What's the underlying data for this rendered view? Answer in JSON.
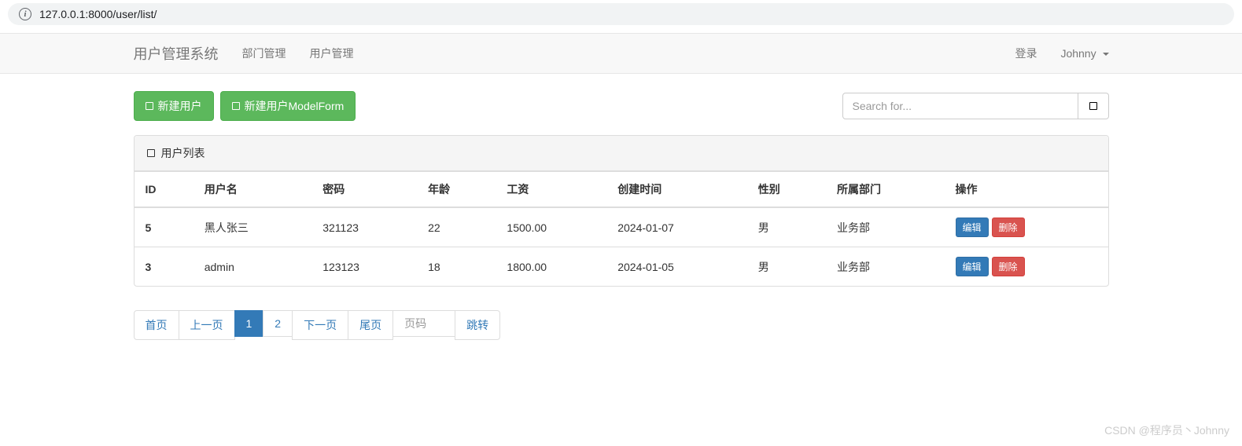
{
  "url": "127.0.0.1:8000/user/list/",
  "nav": {
    "brand": "用户管理系统",
    "items": [
      "部门管理",
      "用户管理"
    ],
    "login": "登录",
    "user": "Johnny"
  },
  "buttons": {
    "new_user": "新建用户",
    "new_user_modelform": "新建用户ModelForm"
  },
  "search": {
    "placeholder": "Search for..."
  },
  "panel": {
    "title": "用户列表"
  },
  "table": {
    "headers": [
      "ID",
      "用户名",
      "密码",
      "年龄",
      "工资",
      "创建时间",
      "性别",
      "所属部门",
      "操作"
    ],
    "rows": [
      {
        "id": "5",
        "username": "黑人张三",
        "password": "321123",
        "age": "22",
        "salary": "1500.00",
        "created": "2024-01-07",
        "gender": "男",
        "dept": "业务部"
      },
      {
        "id": "3",
        "username": "admin",
        "password": "123123",
        "age": "18",
        "salary": "1800.00",
        "created": "2024-01-05",
        "gender": "男",
        "dept": "业务部"
      }
    ],
    "actions": {
      "edit": "编辑",
      "delete": "删除"
    }
  },
  "pagination": {
    "first": "首页",
    "prev": "上一页",
    "pages": [
      "1",
      "2"
    ],
    "active": "1",
    "next": "下一页",
    "last": "尾页",
    "page_placeholder": "页码",
    "jump": "跳转"
  },
  "watermark": "CSDN @程序员丶Johnny"
}
